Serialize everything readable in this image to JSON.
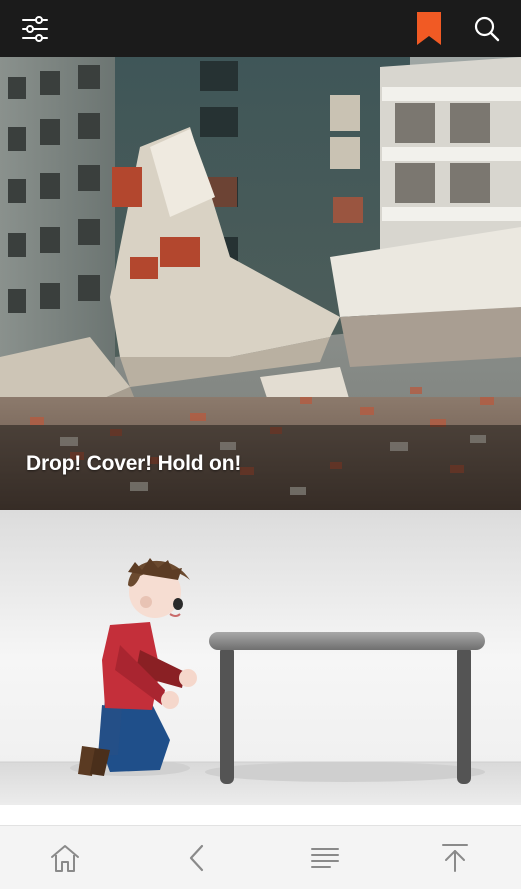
{
  "app": {
    "top_bar": {
      "icons": [
        "sliders-filter-icon",
        "bookmark-icon",
        "search-icon"
      ],
      "accent_color": "#f15a24",
      "background": "#1b1b1b"
    },
    "article": {
      "hero_caption": "Drop! Cover! Hold on!",
      "hero_image": "collapsed-building-rubble-photo",
      "illustration": "person-kneeling-beside-table-illustration"
    },
    "bottom_bar": {
      "icons": [
        "home-icon",
        "back-chevron-icon",
        "menu-lines-icon",
        "scroll-to-top-icon"
      ],
      "icon_color": "#8a8a8a"
    }
  }
}
